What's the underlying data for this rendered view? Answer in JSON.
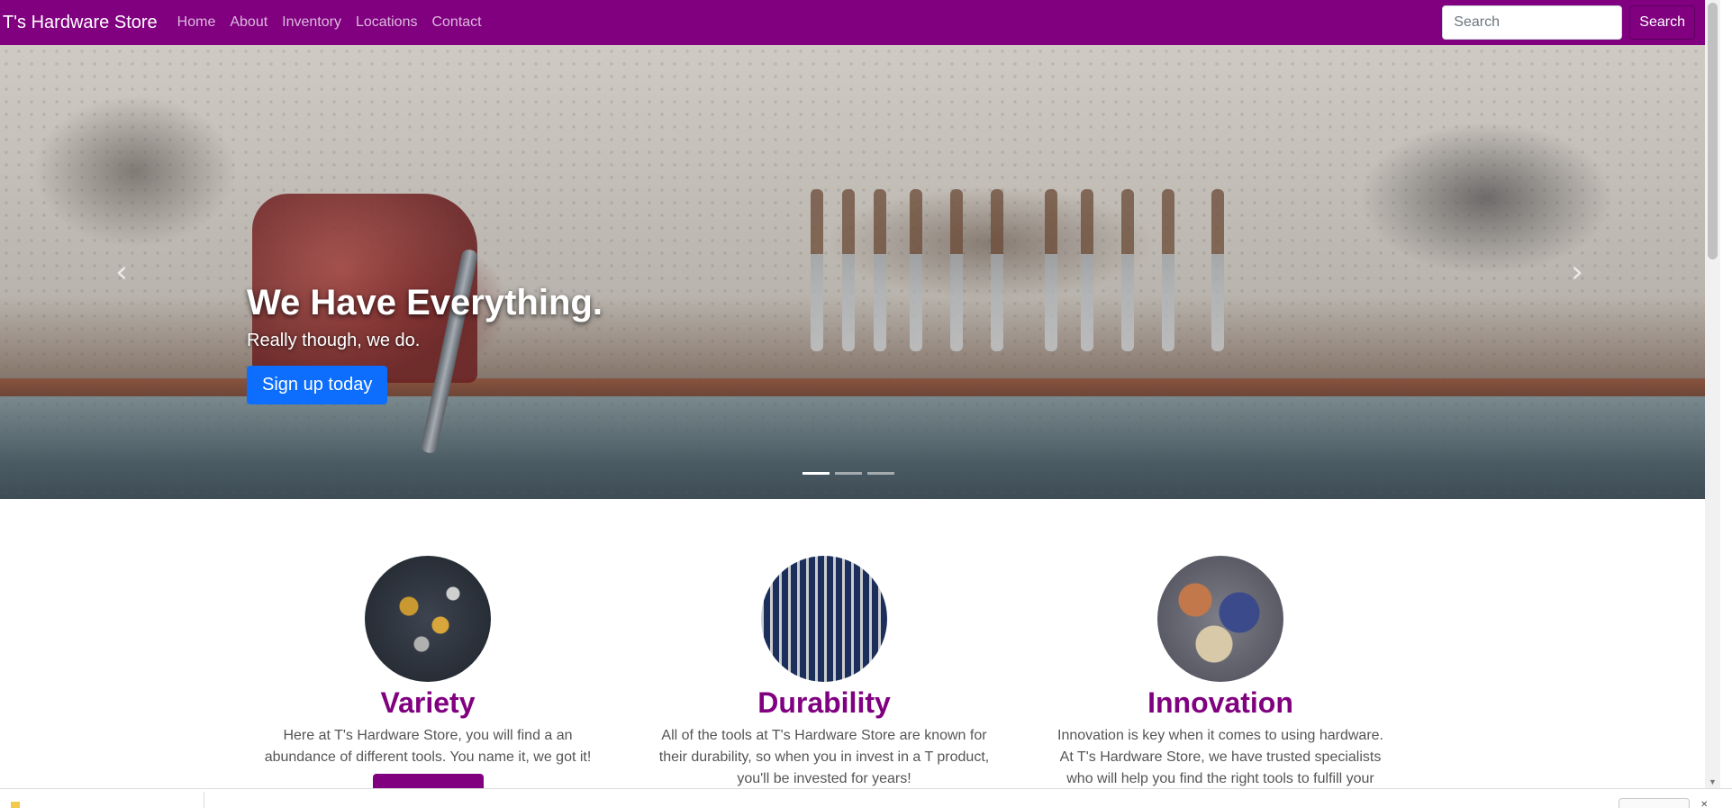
{
  "navbar": {
    "brand": "T's Hardware Store",
    "links": [
      "Home",
      "About",
      "Inventory",
      "Locations",
      "Contact"
    ],
    "search_placeholder": "Search",
    "search_button": "Search",
    "background_color": "#800080"
  },
  "carousel": {
    "title": "We Have Everything.",
    "subtitle": "Really though, we do.",
    "button": "Sign up today",
    "prev_icon": "chevron-left-icon",
    "next_icon": "chevron-right-icon",
    "slide_count": 3,
    "active_slide": 0,
    "button_color": "#0d6efd"
  },
  "features": [
    {
      "title": "Variety",
      "text": "Here at T's Hardware Store, you will find a an abundance of different tools. You name it, we got it!"
    },
    {
      "title": "Durability",
      "text": "All of the tools at T's Hardware Store are known for their durability, so when you in invest in a T product, you'll be invested for years!"
    },
    {
      "title": "Innovation",
      "text": "Innovation is key when it comes to using hardware. At T's Hardware Store, we have trusted specialists who will help you find the right tools to fulfill your creative"
    }
  ],
  "colors": {
    "accent": "#800080",
    "feature_text": "#555555"
  }
}
